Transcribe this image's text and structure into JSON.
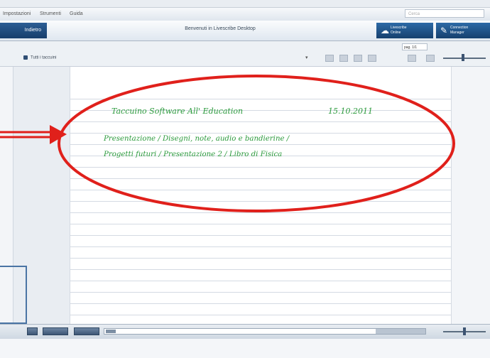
{
  "menubar": {
    "items": [
      "Impostazioni",
      "Strumenti",
      "Guida"
    ],
    "search_placeholder": "Cerca"
  },
  "titlebar": {
    "back_label": "Indietro",
    "document_title": "Benvenuti in Livescribe Desktop",
    "app_buttons": [
      {
        "line1": "Livescribe",
        "line2": "Online",
        "icon": "cloud-icon"
      },
      {
        "line1": "Connection",
        "line2": "Manager",
        "icon": "pen-icon"
      }
    ]
  },
  "toolbar": {
    "view_menu_label": "Tutti i taccuini",
    "page_field_value": "pag. 1/1"
  },
  "notebook": {
    "handwriting": {
      "line1": "Taccuino Software All' Education",
      "date": "15.10.2011",
      "line2": "Presentazione / Disegni, note, audio e bandierine /",
      "line3": "Progetti futuri / Presentazione 2 / Libro di Fisica"
    }
  },
  "annotation": {
    "ellipse_color": "#e0201b",
    "arrow_color": "#e0201b"
  },
  "ink_color": "#2b9a3c"
}
